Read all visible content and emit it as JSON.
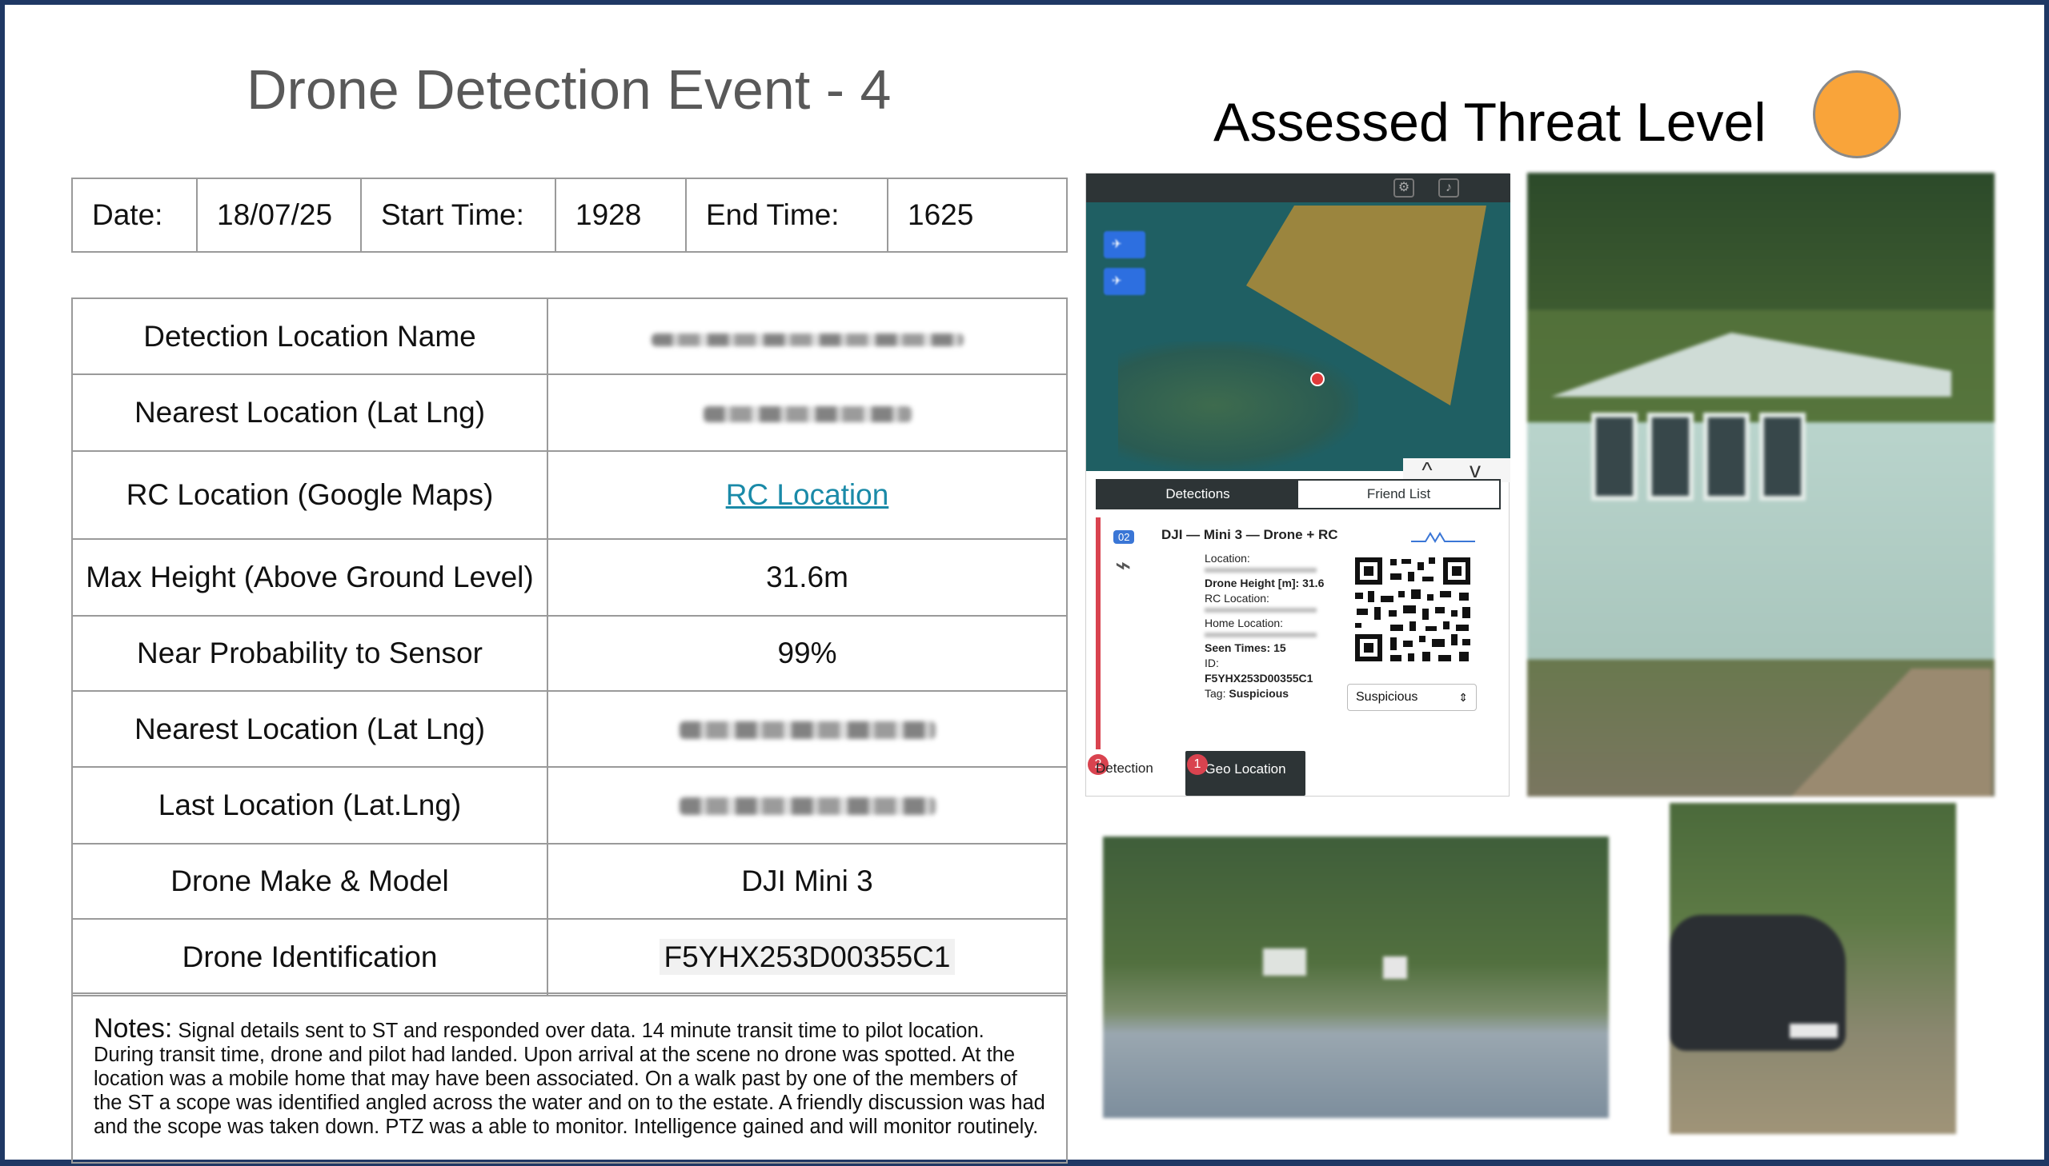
{
  "slide": {
    "title": "Drone Detection Event - 4",
    "threat_title": "Assessed Threat Level",
    "threat_color": "#f9a43a"
  },
  "date_row": {
    "date_label": "Date:",
    "date_value": "18/07/25",
    "start_label": "Start Time:",
    "start_value": "1928",
    "end_label": "End Time:",
    "end_value": "1625"
  },
  "info": {
    "rows": [
      {
        "key": "Detection Location Name",
        "value": ""
      },
      {
        "key": "Nearest Location (Lat Lng)",
        "value": ""
      },
      {
        "key": "RC Location (Google Maps)",
        "value": "RC Location"
      },
      {
        "key": "Max Height (Above Ground Level)",
        "value": "31.6m"
      },
      {
        "key": "Near Probability to Sensor",
        "value": "99%"
      },
      {
        "key": "Nearest Location (Lat Lng)",
        "value": ""
      },
      {
        "key": "Last Location (Lat.Lng)",
        "value": ""
      },
      {
        "key": "Drone Make & Model",
        "value": "DJI Mini 3"
      },
      {
        "key": "Drone Identification",
        "value": "F5YHX253D00355C1"
      }
    ]
  },
  "notes": {
    "label": "Notes:",
    "text": "Signal details sent to ST and responded over data. 14 minute transit time to pilot location. During transit time, drone and pilot had landed. Upon arrival at the scene no drone was spotted. At the location was a mobile home that may have been associated. On a walk past by one of the members of the ST a scope was identified angled across the water and on to the estate. A friendly discussion was had and the scope was taken down. PTZ was a able to monitor. Intelligence gained and will monitor routinely."
  },
  "app": {
    "tabs": {
      "detections": "Detections",
      "friend_list": "Friend List"
    },
    "card": {
      "badge": "02",
      "title": "DJI — Mini 3 — Drone + RC",
      "location_label": "Location:",
      "height_line": "Drone Height [m]: 31.6",
      "rc_label": "RC Location:",
      "home_label": "Home Location:",
      "seen_label": "Seen Times:",
      "seen_value": "15",
      "id_label": "ID:",
      "id_value": "F5YHX253D00355C1",
      "tag_label": "Tag:",
      "tag_value": "Suspicious",
      "select_value": "Suspicious"
    },
    "bottom": {
      "detection_label": "Detection",
      "detection_badge": "2",
      "geo_label": "Geo Location",
      "geo_badge": "1"
    },
    "icons": {
      "nav_up": "^",
      "nav_down": "v"
    },
    "accent_color": "#d9434f"
  }
}
